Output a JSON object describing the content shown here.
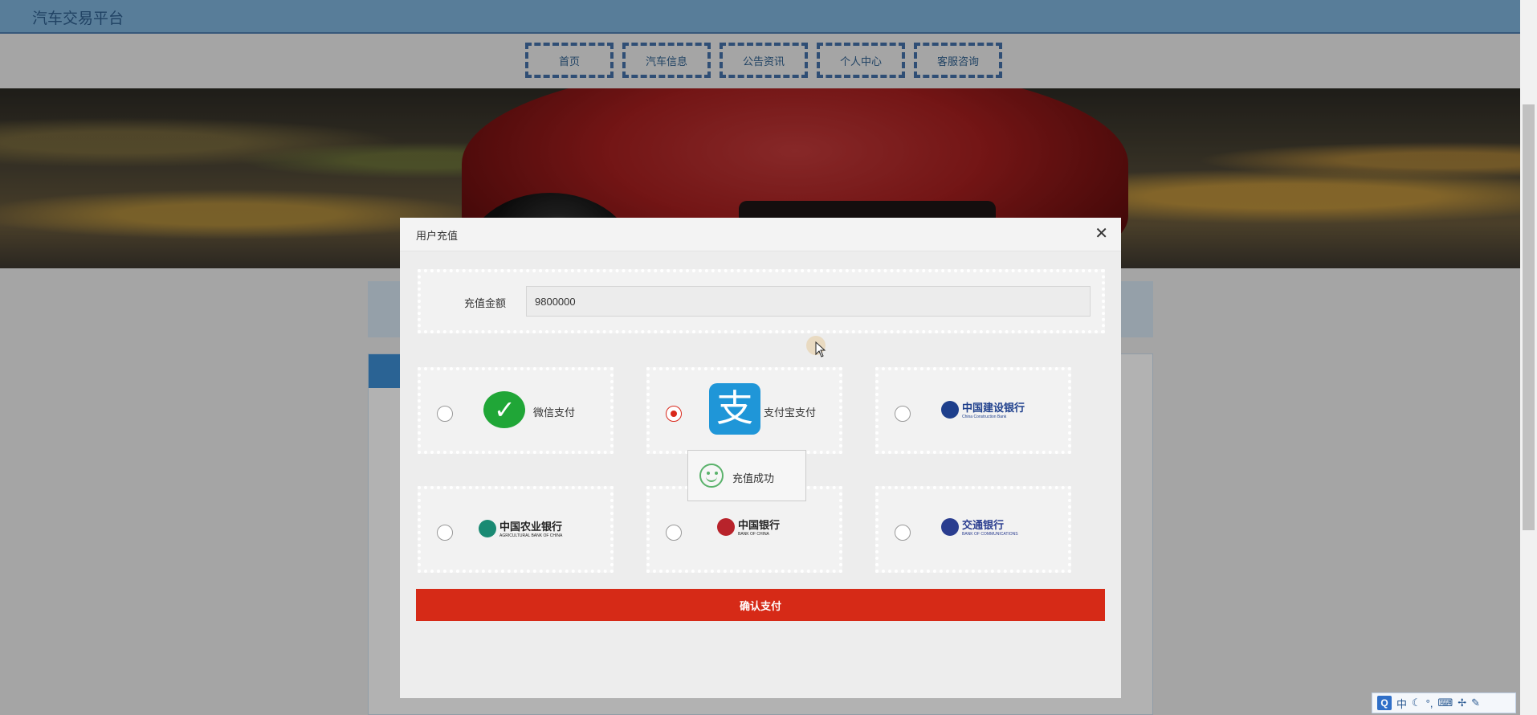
{
  "site": {
    "title": "汽车交易平台"
  },
  "nav": {
    "items": [
      "首页",
      "汽车信息",
      "公告资讯",
      "个人中心",
      "客服咨询"
    ]
  },
  "modal": {
    "title": "用户充值",
    "close_symbol": "✕",
    "amount_label": "充值金额",
    "amount_value": "9800000",
    "payment_options": [
      {
        "label": "微信支付",
        "icon": "wechat-icon",
        "selected": false
      },
      {
        "label": "支付宝支付",
        "icon": "alipay-icon",
        "icon_text": "支",
        "selected": true
      },
      {
        "bank_name": "中国建设银行",
        "bank_sub": "China Construction Bank",
        "icon": "ccb-logo-icon",
        "selected": false
      },
      {
        "bank_name": "中国农业银行",
        "bank_sub": "AGRICULTURAL BANK OF CHINA",
        "icon": "abc-logo-icon",
        "selected": false
      },
      {
        "bank_name": "中国银行",
        "bank_sub": "BANK OF CHINA",
        "icon": "boc-logo-icon",
        "selected": false
      },
      {
        "bank_name": "交通银行",
        "bank_sub": "BANK OF COMMUNICATIONS",
        "icon": "bocom-logo-icon",
        "selected": false
      }
    ],
    "toast": {
      "message": "充值成功",
      "icon": "smiley-icon"
    },
    "confirm_label": "确认支付"
  },
  "ime_toolbar": {
    "logo": "Q",
    "mode": "中",
    "icons": [
      "moon-icon",
      "punctuation-icon",
      "keyboard-icon",
      "tools-icon",
      "wrench-icon"
    ]
  },
  "colors": {
    "topbar": "#7fb3dc",
    "nav_border": "#4470a8",
    "confirm": "#d62a17",
    "radio_selected": "#d9281b",
    "alipay": "#1f96d8",
    "wechat": "#20a637",
    "toast_icon": "#5ab26b"
  }
}
